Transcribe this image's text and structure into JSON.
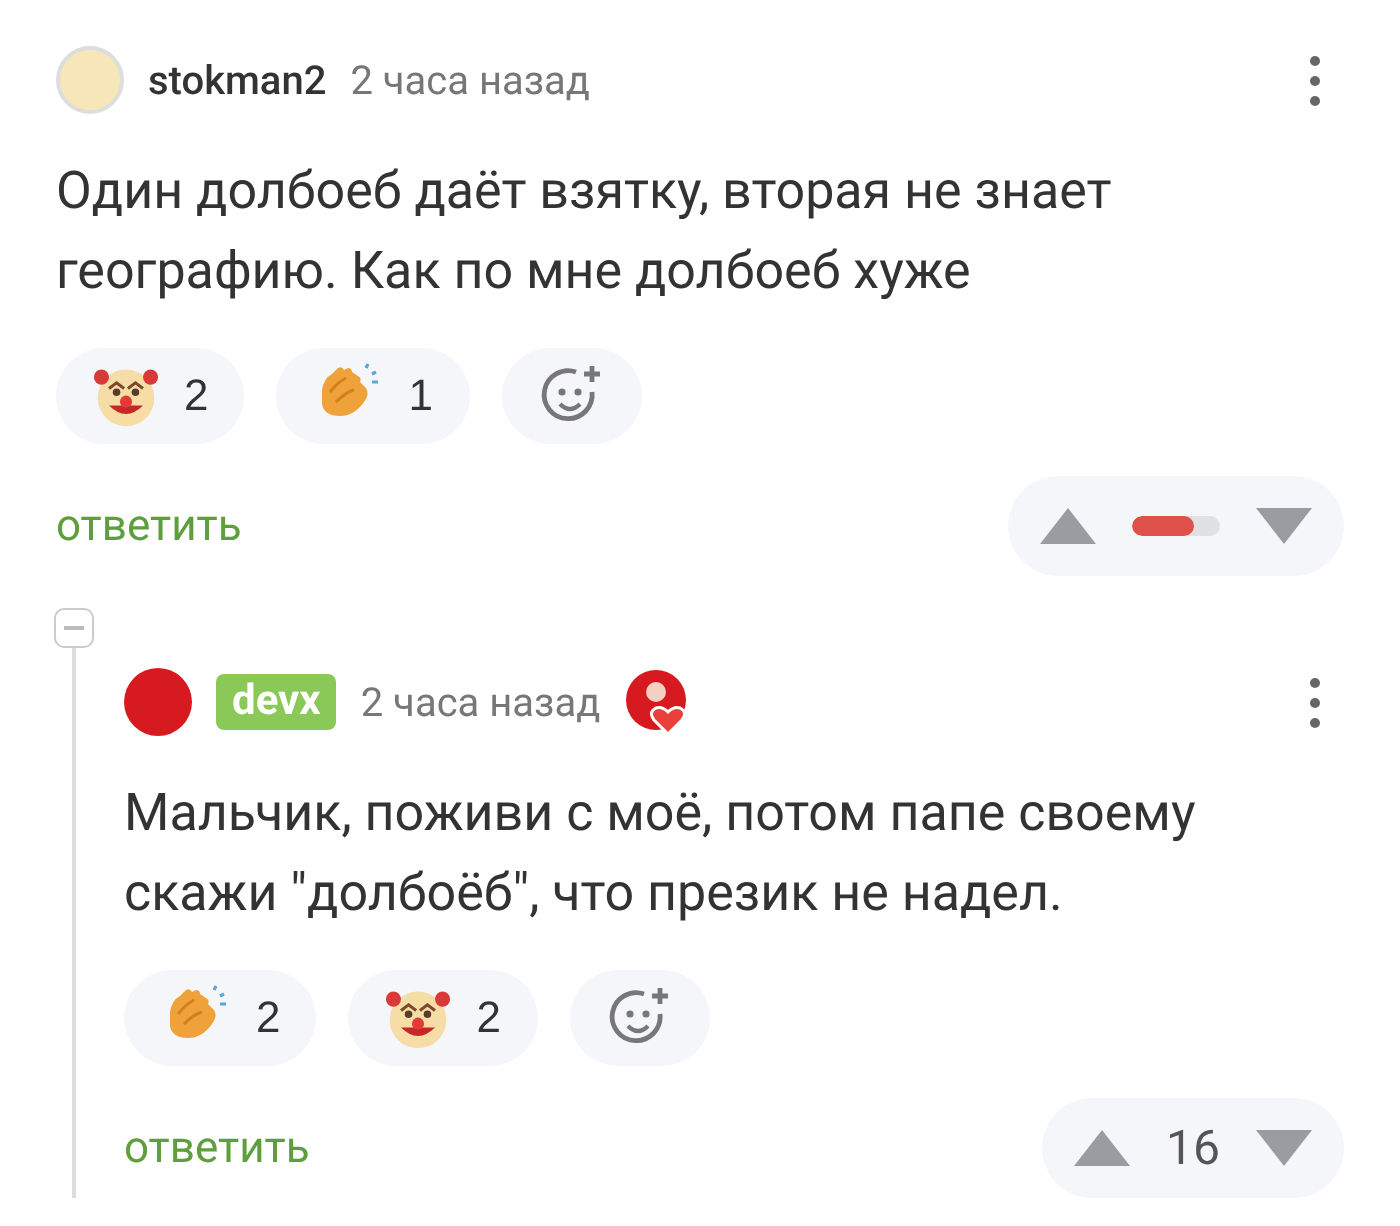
{
  "comments": [
    {
      "author": "stokman2",
      "author_highlight": false,
      "time": "2 часа назад",
      "award": false,
      "text": "Один долбоеб даёт взятку, вторая не знает географию. Как по мне долбоеб хуже",
      "reactions": [
        {
          "kind": "clown",
          "count": "2"
        },
        {
          "kind": "clap",
          "count": "1"
        }
      ],
      "reply": "ответить",
      "rating": {
        "kind": "meter",
        "level": 0.7
      },
      "children": [
        {
          "author": "devx",
          "author_highlight": true,
          "time": "2 часа назад",
          "award": true,
          "text": "Мальчик, поживи с моё, потом папе своему скажи \"долбоёб\", что презик не надел.",
          "reactions": [
            {
              "kind": "clap",
              "count": "2"
            },
            {
              "kind": "clown",
              "count": "2"
            }
          ],
          "reply": "ответить",
          "rating": {
            "kind": "number",
            "value": "16"
          }
        }
      ]
    }
  ]
}
